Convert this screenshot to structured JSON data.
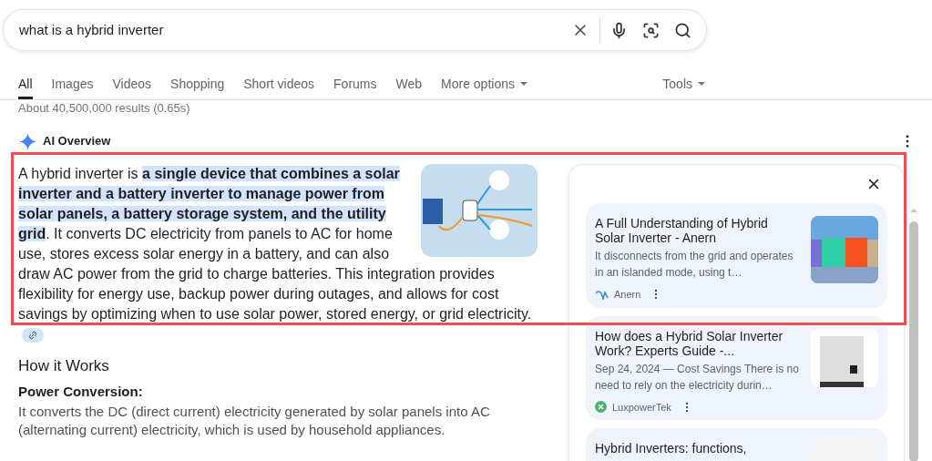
{
  "search": {
    "value": "what is a hybrid inverter"
  },
  "tabs": [
    {
      "label": "All",
      "selected": true
    },
    {
      "label": "Images",
      "selected": false
    },
    {
      "label": "Videos",
      "selected": false
    },
    {
      "label": "Shopping",
      "selected": false
    },
    {
      "label": "Short videos",
      "selected": false
    },
    {
      "label": "Forums",
      "selected": false
    },
    {
      "label": "Web",
      "selected": false
    },
    {
      "label": "More options",
      "selected": false,
      "kind": "dropdown"
    }
  ],
  "tools": {
    "label": "Tools"
  },
  "result_stats": "About 40,500,000 results (0.65s)",
  "ai_overview": {
    "title": "AI Overview",
    "summary": [
      {
        "text": "A hybrid inverter is ",
        "highlighted": false
      },
      {
        "text": "a single device that combines a solar inverter and a battery inverter to manage power from solar panels, a battery storage system, and the utility grid",
        "highlighted": true
      },
      {
        "text": ". It converts DC electricity from panels to AC for home use, stores excess solar energy in a battery, and can also draw AC power from the grid to charge batteries. This integration provides flexibility for energy use, backup power during outages, and allows for cost savings by optimizing when to use solar power, stored energy, or grid electricity.",
        "highlighted": false
      }
    ],
    "section_heading": "How it Works",
    "points": [
      {
        "title": "Power Conversion:",
        "text": "It converts the DC (direct current) electricity generated by solar panels into AC (alternating current) electricity, which is used by household appliances."
      }
    ]
  },
  "sources": [
    {
      "title": "A Full Understanding of Hybrid Solar Inverter - Anern",
      "snippet": "It disconnects from the grid and operates in an islanded mode, using t…",
      "site": "Anern",
      "kind": "colored-inverters"
    },
    {
      "title": "How does a Hybrid Solar Inverter Work? Experts Guide -...",
      "snippet": "Sep 24, 2024 — Cost Savings There is no need to rely on the electricity durin…",
      "site": "LuxpowerTek",
      "kind": "grey-inverter"
    },
    {
      "title": "Hybrid Inverters: functions,",
      "kind": "blank"
    }
  ]
}
